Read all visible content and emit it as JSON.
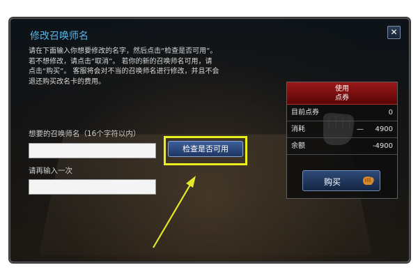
{
  "dialog": {
    "title": "修改召唤师名",
    "close_label": "✕",
    "instructions": [
      "请在下面输入你想要修改的名字，然后点击“检查是否可用”。",
      "若不想修改，请点击“取消”。 若你的新的召唤师名可用，请",
      "点击“购买”。 客服将会对不当的召唤师名进行修改，并且不会",
      "退还购买改名卡的费用。"
    ]
  },
  "form": {
    "name_label": "想要的召唤师名（16个字符以内）",
    "name_value": "",
    "confirm_label": "请再输入一次",
    "confirm_value": "",
    "check_button": "检查是否可用"
  },
  "panel": {
    "header_line1": "使用",
    "header_line2": "点券",
    "rows": [
      {
        "label": "目前点券",
        "mid": "",
        "value": "0"
      },
      {
        "label": "消耗",
        "mid": "—",
        "value": "4900"
      },
      {
        "label": "余额",
        "mid": "",
        "value": "-4900"
      }
    ],
    "buy_button": "购买"
  },
  "colors": {
    "title": "#58b5e8",
    "highlight": "#ecef1e",
    "panel_header": "#8b1010"
  },
  "icons": {
    "close": "close-icon",
    "arrow": "annotation-arrow",
    "emblem": "fist-emblem-icon",
    "buy": "riot-points-icon"
  }
}
